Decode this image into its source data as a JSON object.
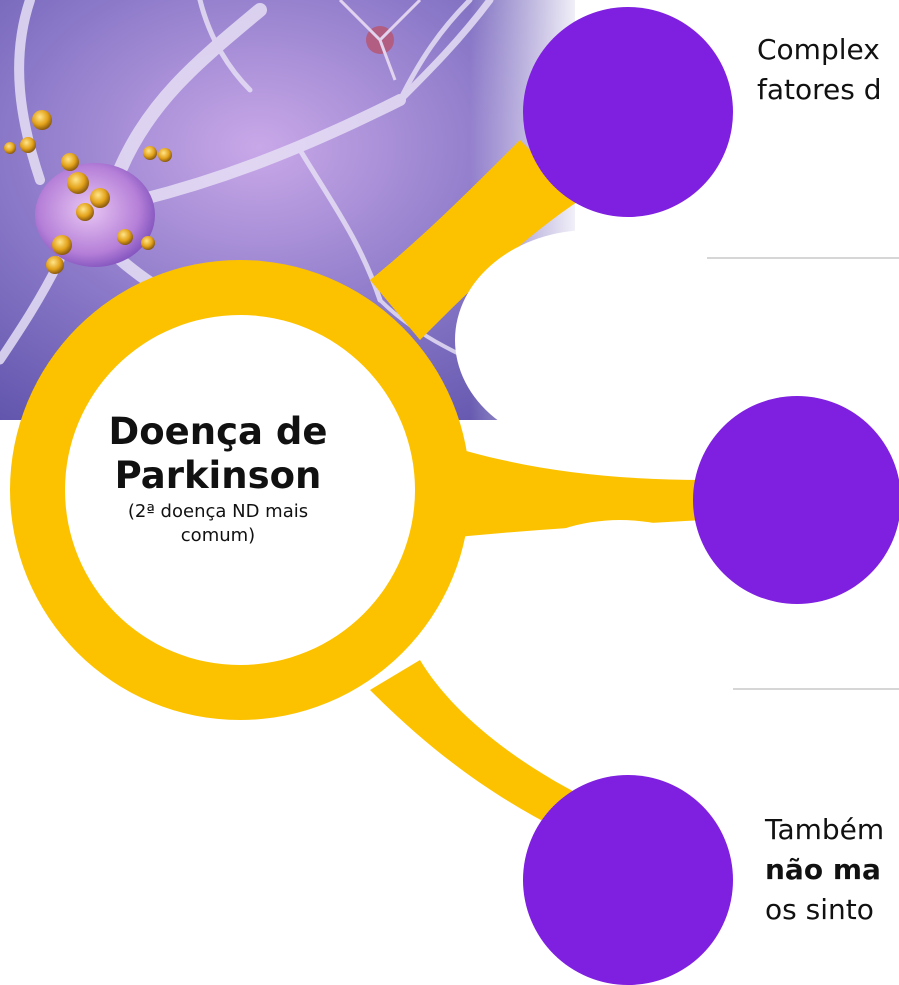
{
  "center": {
    "title_line1": "Doença de",
    "title_line2": "Parkinson",
    "subtitle_line1": "(2ª doença ND mais",
    "subtitle_line2": "comum)"
  },
  "branch_top": {
    "line1": "Complex",
    "line2": "fatores d"
  },
  "branch_bottom": {
    "line1": "Também",
    "line2": "não ma",
    "line3": "os sinto"
  },
  "colors": {
    "connector": "#fcc200",
    "node": "#7f1fe0",
    "hub_fill": "#ffffff",
    "divider": "#c8c8c8"
  }
}
